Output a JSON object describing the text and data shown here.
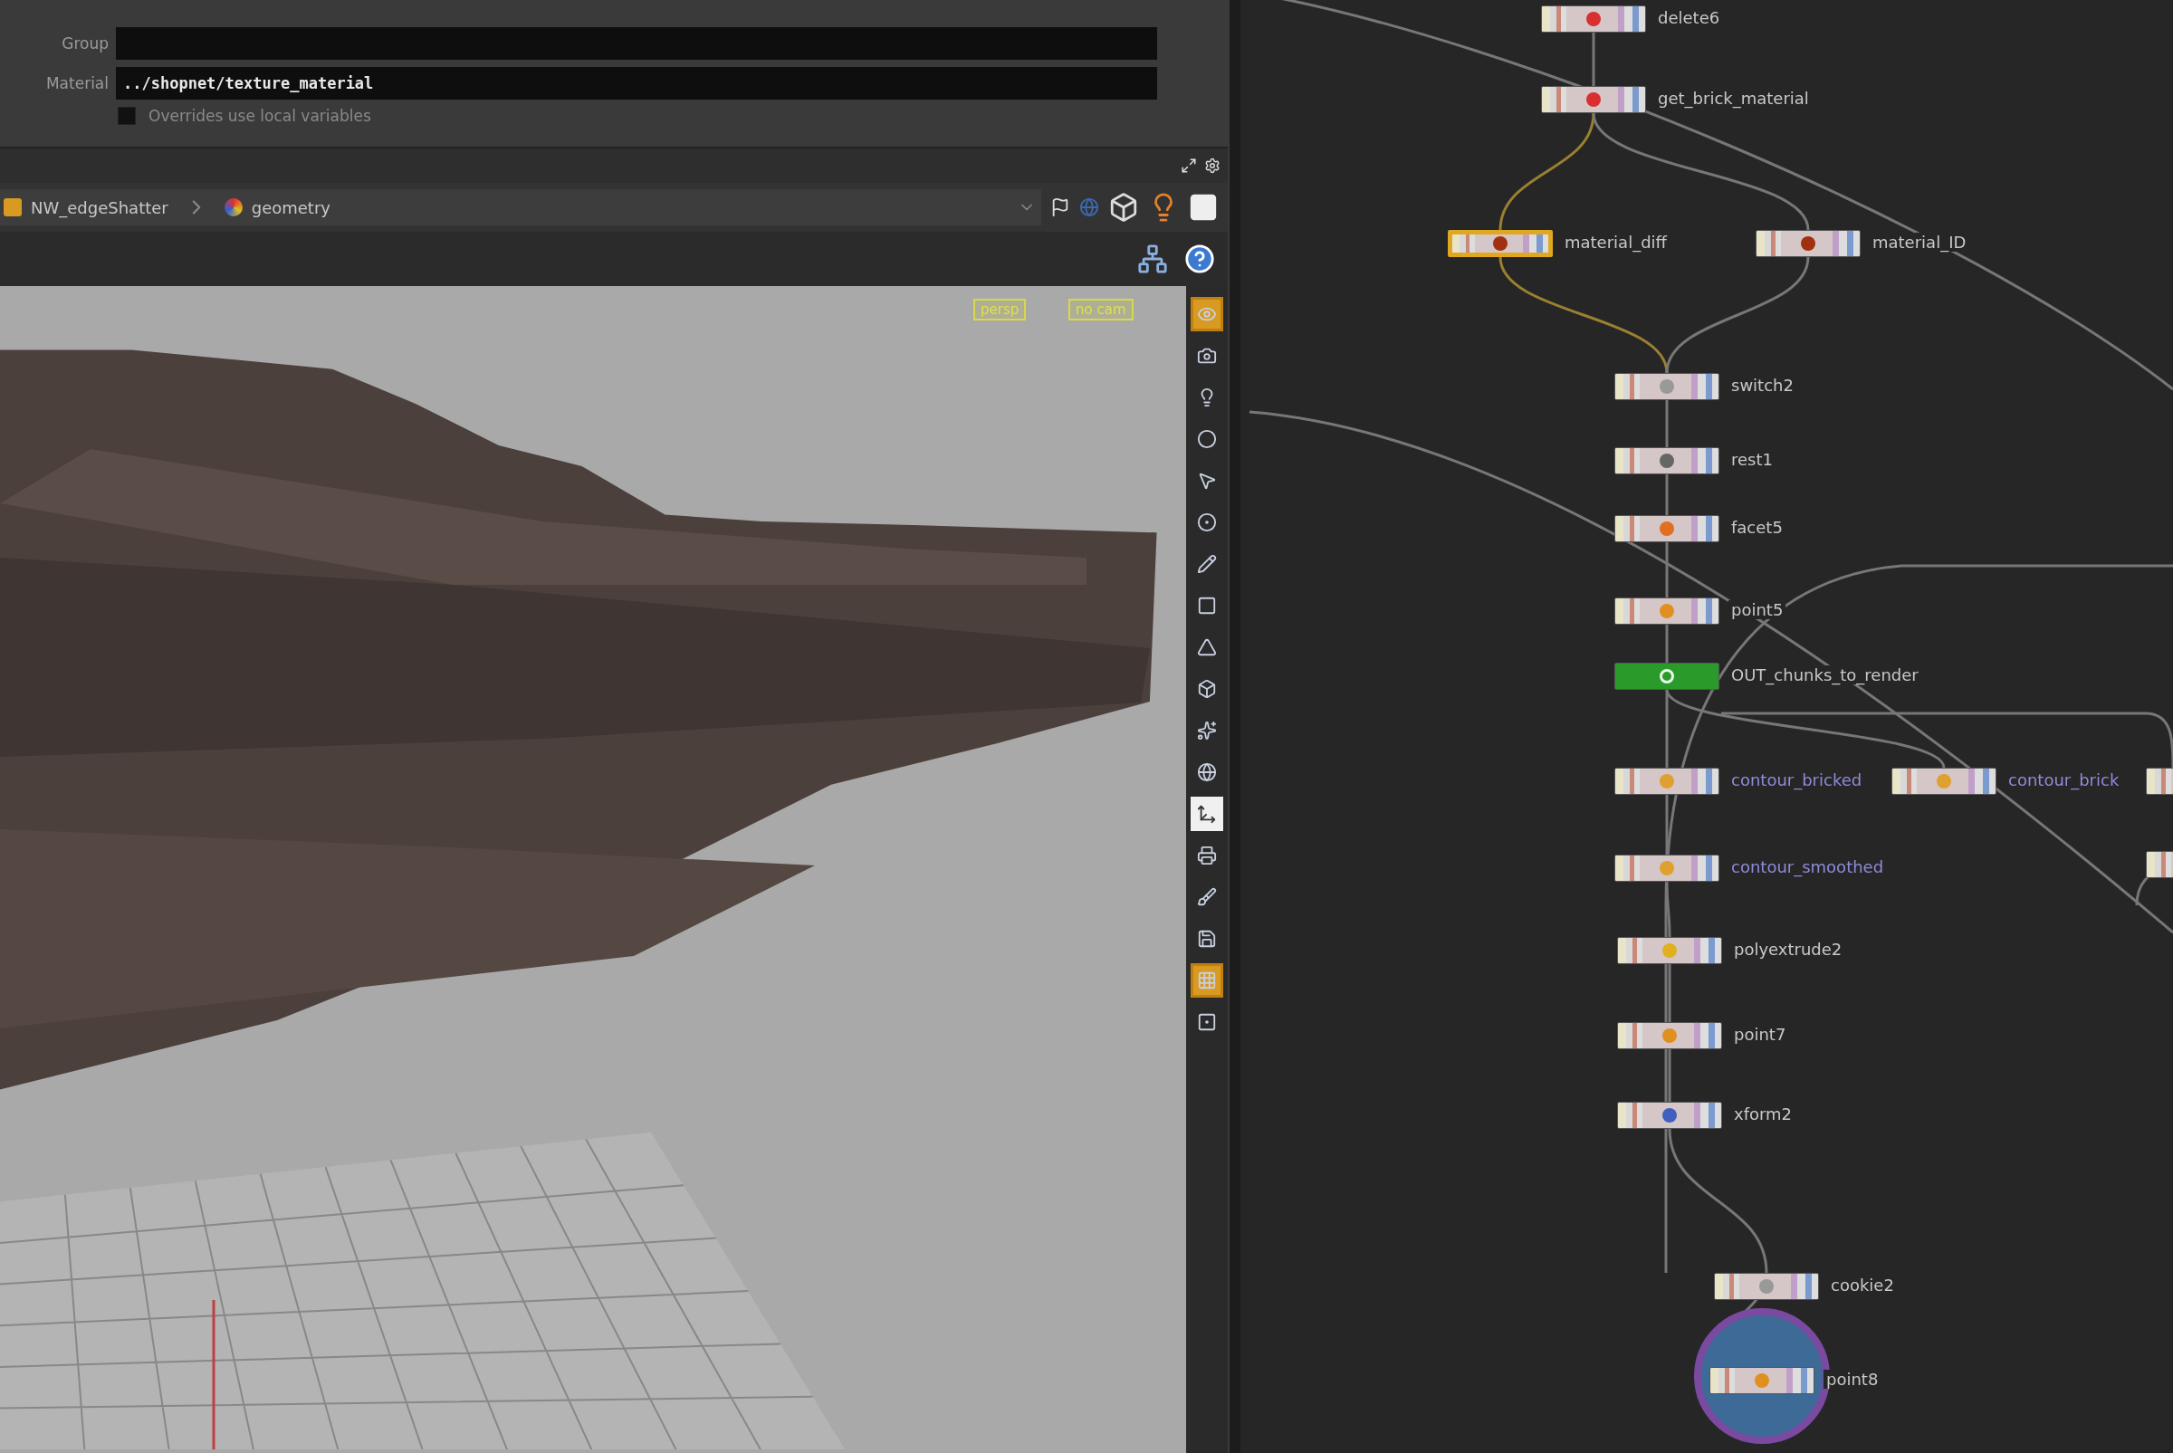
{
  "parameters": {
    "group": {
      "label": "Group"
    },
    "material": {
      "label": "Material",
      "value": "../shopnet/texture_material"
    },
    "overrides": {
      "label": "Overrides use local variables",
      "checked": false
    }
  },
  "path_bar": {
    "crumbs": [
      "NW_edgeShatter",
      "geometry"
    ]
  },
  "viewport": {
    "camera_menus": [
      "persp",
      "no cam"
    ],
    "tools": [
      {
        "on": true,
        "selected": false
      },
      {
        "on": false,
        "selected": false
      },
      {
        "on": false,
        "selected": false
      },
      {
        "on": false,
        "selected": false
      },
      {
        "on": false,
        "selected": false
      },
      {
        "on": false,
        "selected": false
      },
      {
        "on": false,
        "selected": false
      },
      {
        "on": false,
        "selected": false
      },
      {
        "on": false,
        "selected": false
      },
      {
        "on": false,
        "selected": false
      },
      {
        "on": false,
        "selected": false
      },
      {
        "on": false,
        "selected": false
      },
      {
        "on": false,
        "selected": true
      },
      {
        "on": false,
        "selected": false
      },
      {
        "on": false,
        "selected": false
      },
      {
        "on": false,
        "selected": false
      },
      {
        "on": true,
        "selected": false
      },
      {
        "on": false,
        "selected": false
      }
    ]
  },
  "network": {
    "nodes": [
      {
        "name": "delete6",
        "selected": false,
        "display": false,
        "current": false,
        "color": "#c8c8c8"
      },
      {
        "name": "get_brick_material",
        "selected": false,
        "display": false,
        "current": false,
        "color": "#c8c8c8"
      },
      {
        "name": "material_diff",
        "selected": true,
        "display": false,
        "current": false,
        "color": "#c8c8c8"
      },
      {
        "name": "material_ID",
        "selected": false,
        "display": false,
        "current": false,
        "color": "#c8c8c8"
      },
      {
        "name": "switch2",
        "selected": false,
        "display": false,
        "current": false,
        "color": "#c8c8c8"
      },
      {
        "name": "rest1",
        "selected": false,
        "display": false,
        "current": false,
        "color": "#c8c8c8"
      },
      {
        "name": "facet5",
        "selected": false,
        "display": false,
        "current": false,
        "color": "#c8c8c8"
      },
      {
        "name": "point5",
        "selected": false,
        "display": false,
        "current": false,
        "color": "#c8c8c8"
      },
      {
        "name": "OUT_chunks_to_render",
        "selected": false,
        "display": true,
        "current": false,
        "color": "#c8c8c8"
      },
      {
        "name": "contour_bricked",
        "selected": false,
        "display": false,
        "current": false,
        "color": "#8f8ad8"
      },
      {
        "name": "contour_brick",
        "selected": false,
        "display": false,
        "current": false,
        "color": "#8f8ad8"
      },
      {
        "name": "contour_smoothed",
        "selected": false,
        "display": false,
        "current": false,
        "color": "#8f8ad8"
      },
      {
        "name": "polyextrude2",
        "selected": false,
        "display": false,
        "current": false,
        "color": "#c8c8c8"
      },
      {
        "name": "point7",
        "selected": false,
        "display": false,
        "current": false,
        "color": "#c8c8c8"
      },
      {
        "name": "xform2",
        "selected": false,
        "display": false,
        "current": false,
        "color": "#c8c8c8"
      },
      {
        "name": "cookie2",
        "selected": false,
        "display": false,
        "current": false,
        "color": "#c8c8c8"
      },
      {
        "name": "point8",
        "selected": false,
        "display": false,
        "current": true,
        "color": "#c8c8c8"
      }
    ]
  }
}
